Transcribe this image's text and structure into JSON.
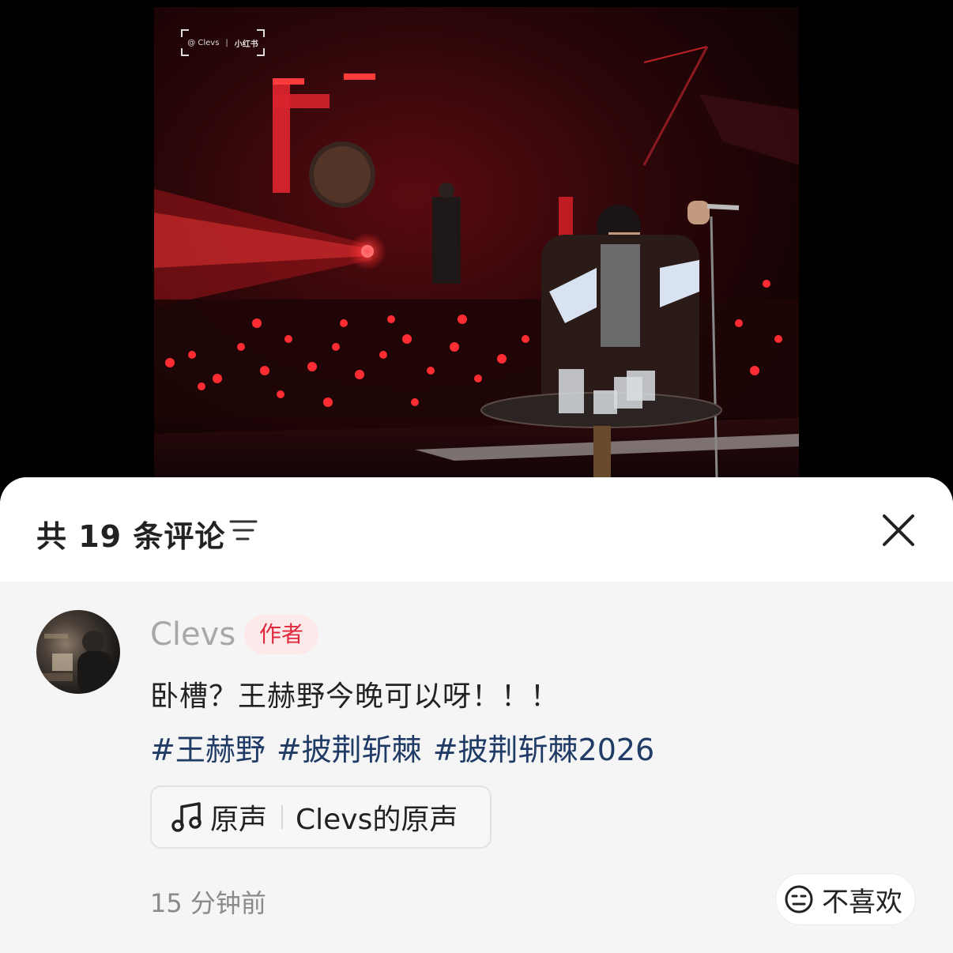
{
  "video": {
    "watermark_user": "@ Clevs",
    "watermark_separator": "|",
    "watermark_brand": "小红书"
  },
  "header": {
    "comment_count_label": "共 19 条评论"
  },
  "comment": {
    "username": "Clevs",
    "badge": "作者",
    "text": "卧槽？王赫野今晚可以呀！！！",
    "hashtags": [
      "#王赫野",
      "#披荆斩棘",
      "#披荆斩棘2026"
    ],
    "sound": {
      "label": "原声",
      "name": "Clevs的原声"
    },
    "time": "15 分钟前",
    "dislike_label": "不喜欢"
  },
  "colors": {
    "badge_text": "#e0283c",
    "badge_bg": "#fde8ea",
    "hashtag": "#1f3b66"
  }
}
